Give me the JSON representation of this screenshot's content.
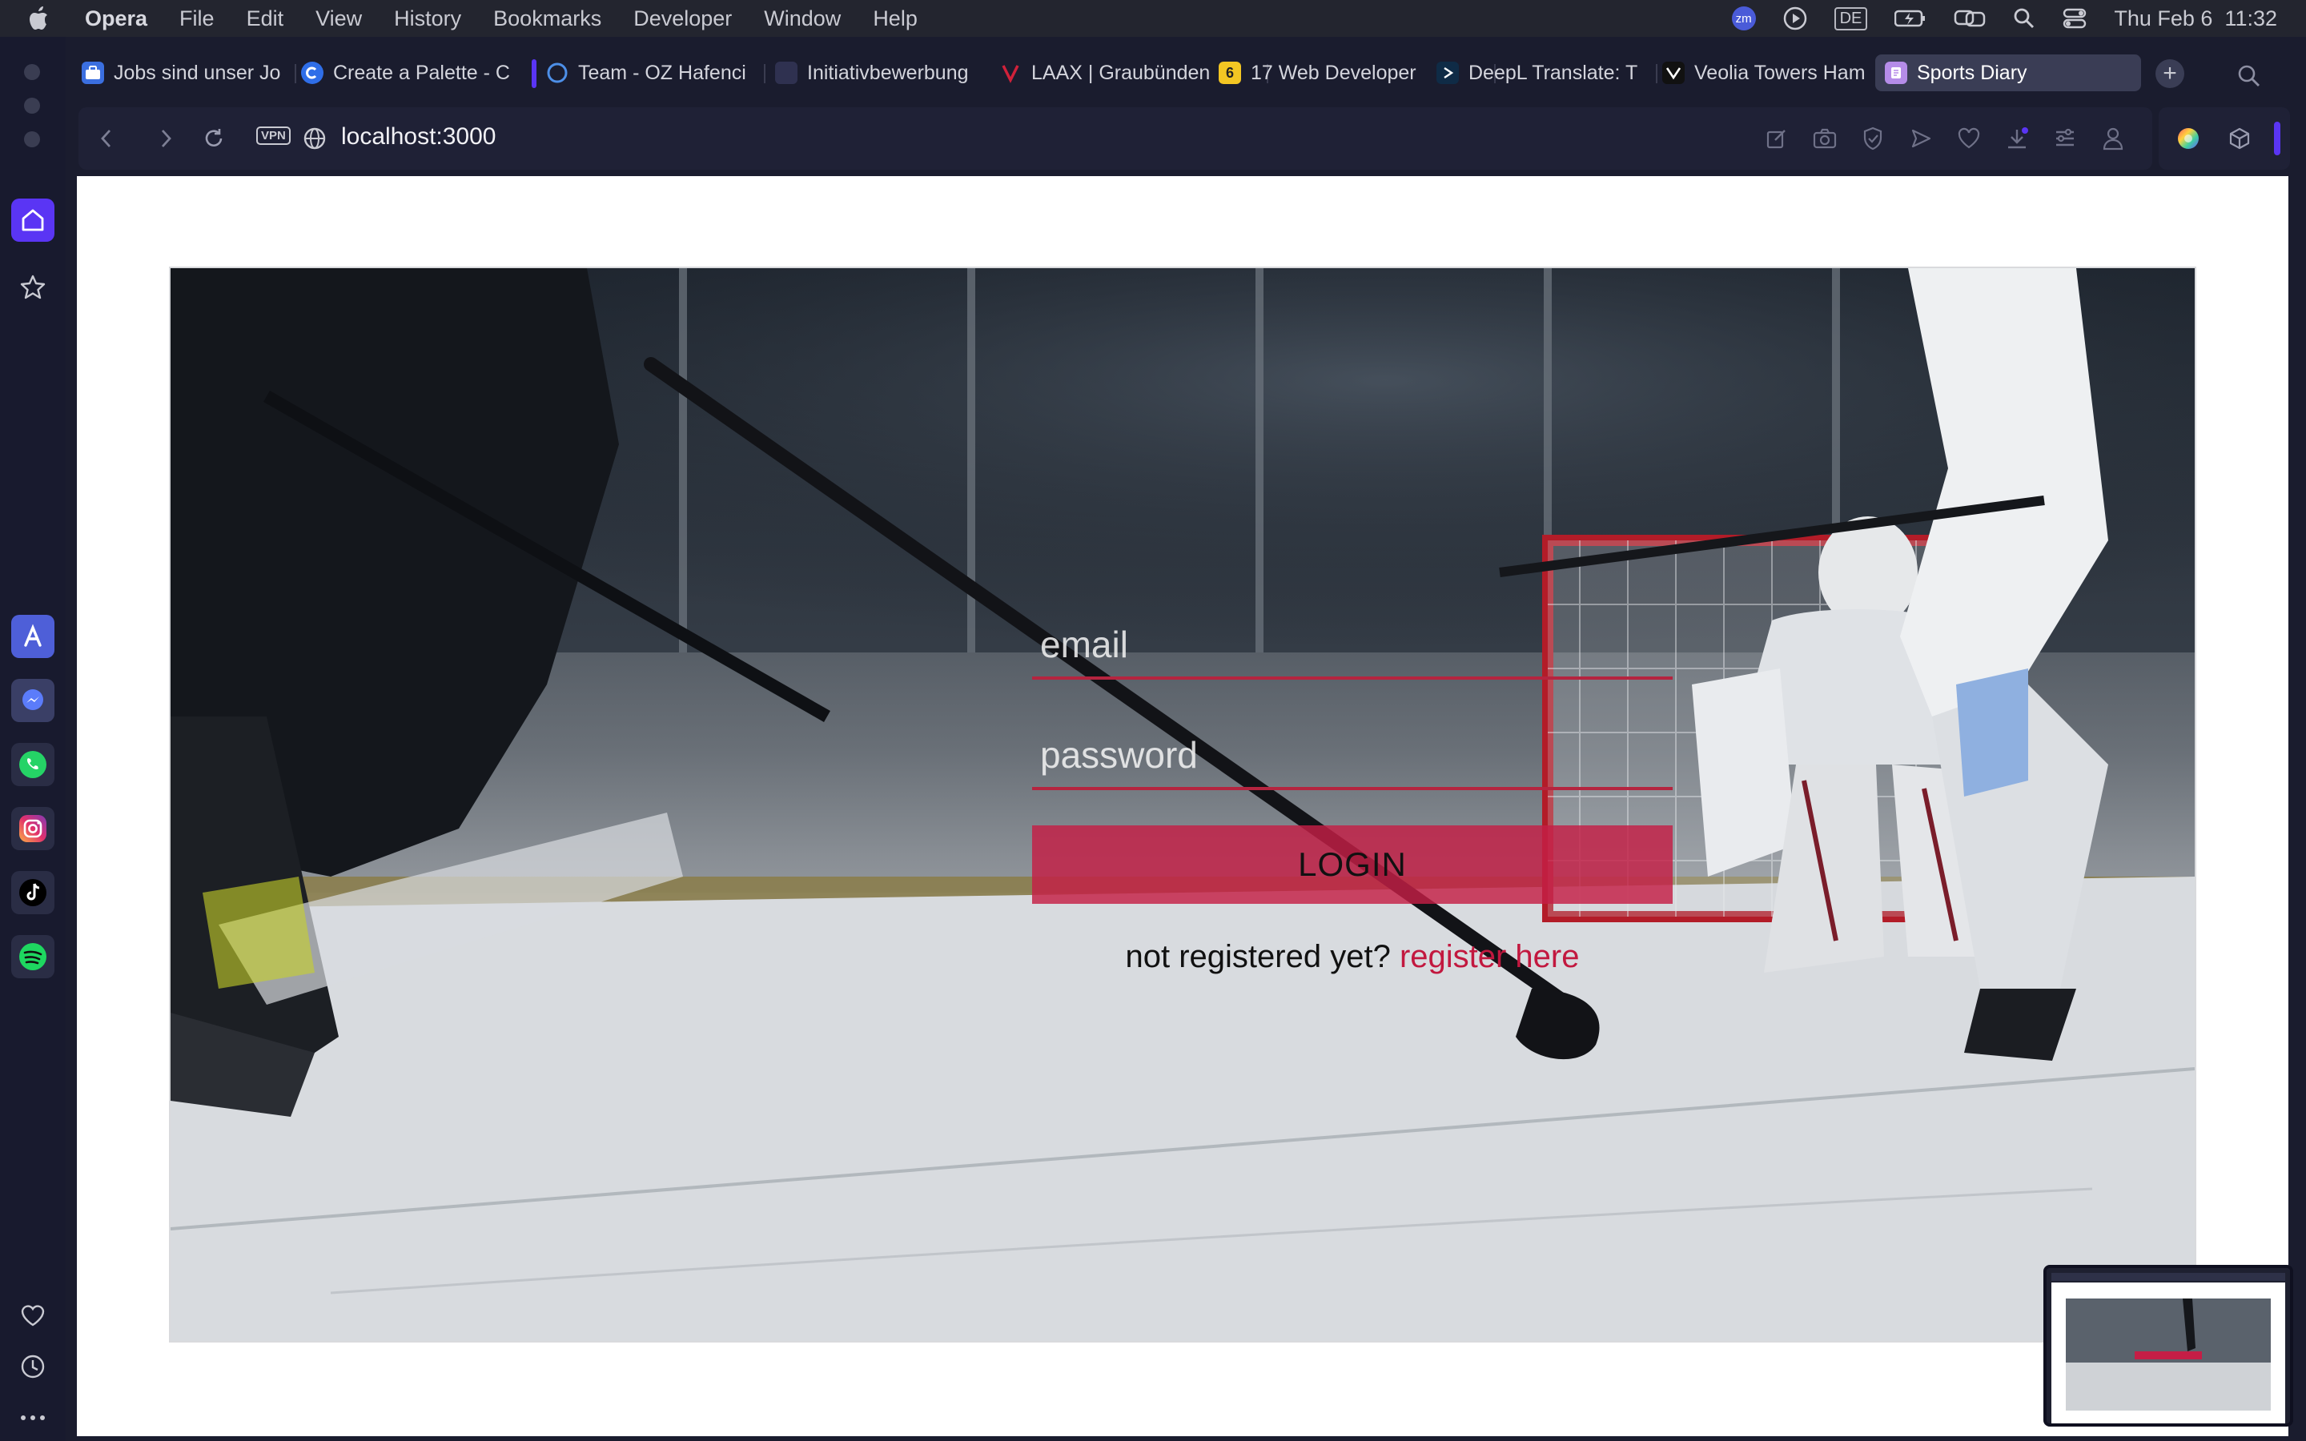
{
  "menubar": {
    "app_name": "Opera",
    "items": [
      "File",
      "Edit",
      "View",
      "History",
      "Bookmarks",
      "Developer",
      "Window",
      "Help"
    ],
    "keyboard_layout": "DE",
    "zoom_badge": "zm",
    "datetime": "Thu Feb 6  11:32"
  },
  "tabs": [
    {
      "label": "Jobs sind unser Jo",
      "favicon_color": "#3b6fe0",
      "icon": "briefcase-favicon"
    },
    {
      "label": "Create a Palette - C",
      "favicon_color": "#2f6ee8",
      "icon": "coolors-favicon"
    },
    {
      "label": "Team - OZ Hafenci",
      "favicon_color": "#2d6fe0",
      "icon": "ring-favicon"
    },
    {
      "label": "Initiativbewerbung",
      "favicon_color": "#2f3150",
      "icon": "document-favicon"
    },
    {
      "label": "LAAX | Graubünden",
      "favicon_color": "#d0213a",
      "icon": "laax-favicon"
    },
    {
      "label": "17 Web Developer",
      "favicon_color": "#f3c623",
      "icon": "medal-favicon"
    },
    {
      "label": "DeepL Translate: T",
      "favicon_color": "#0f2b46",
      "icon": "deepl-favicon"
    },
    {
      "label": "Veolia Towers Ham",
      "favicon_color": "#111111",
      "icon": "veolia-favicon"
    },
    {
      "label": "Sports Diary",
      "favicon_color": "#b58ce8",
      "icon": "diary-favicon",
      "active": true
    }
  ],
  "address": {
    "vpn": "VPN",
    "url": "localhost:3000"
  },
  "login": {
    "email_placeholder": "email",
    "password_placeholder": "password",
    "login_button": "LOGIN",
    "register_prompt": "not registered yet?",
    "register_link": "register here"
  },
  "colors": {
    "accent": "#5a35f4",
    "brand": "#c2183f",
    "login_button": "#c51e46"
  }
}
